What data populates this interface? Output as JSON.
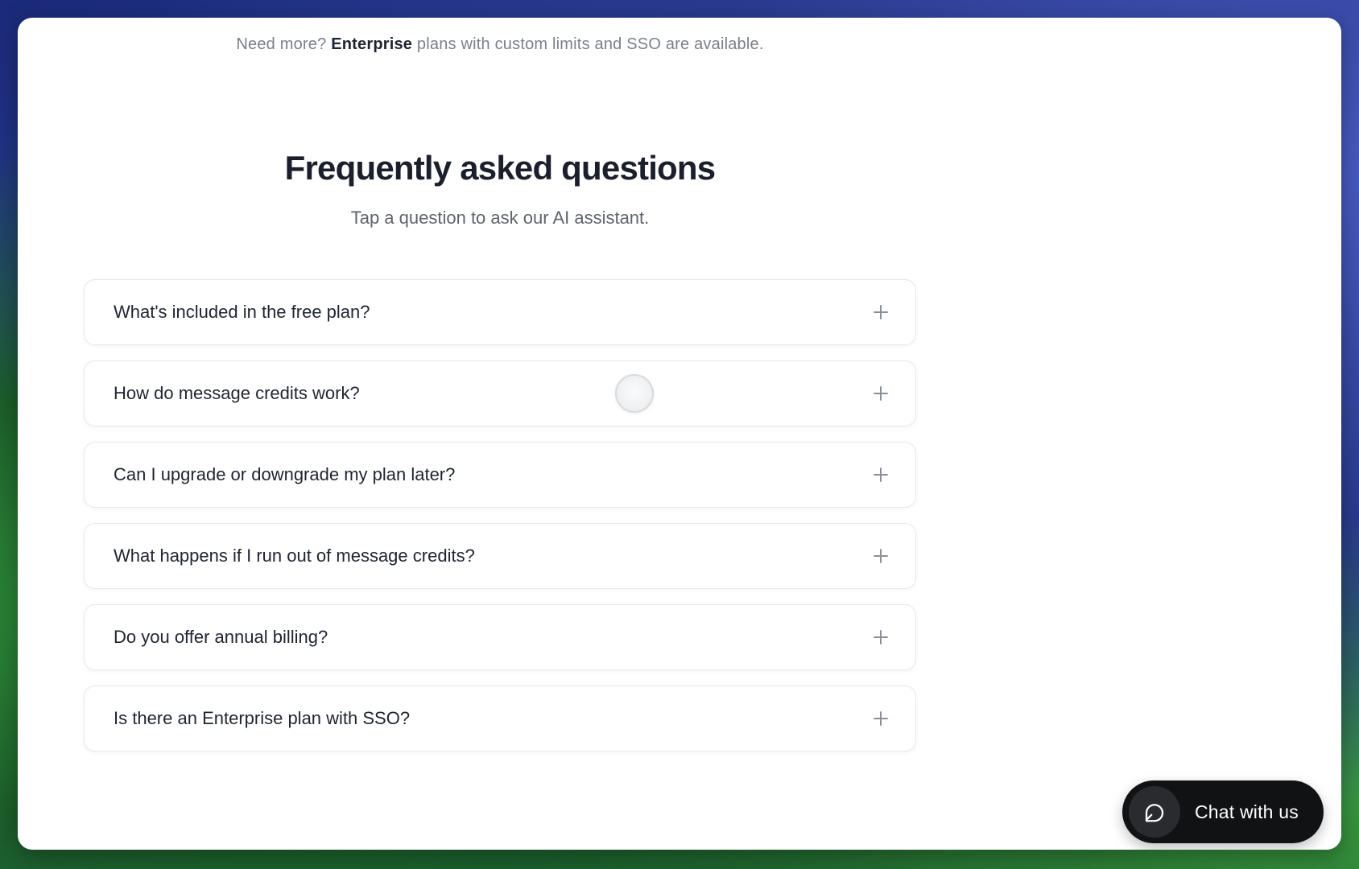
{
  "notice": {
    "prefix": "Need more?",
    "strong": "Enterprise",
    "suffix": "plans with custom limits and SSO are available."
  },
  "faq": {
    "title": "Frequently asked questions",
    "subtitle": "Tap a question to ask our AI assistant.",
    "items": [
      {
        "question": "What's included in the free plan?"
      },
      {
        "question": "How do message credits work?"
      },
      {
        "question": "Can I upgrade or downgrade my plan later?"
      },
      {
        "question": "What happens if I run out of message credits?"
      },
      {
        "question": "Do you offer annual billing?"
      },
      {
        "question": "Is there an Enterprise plan with SSO?"
      }
    ],
    "expand_icon": "plus-icon"
  },
  "chat_widget": {
    "label": "Chat with us",
    "icon": "chat-bubble-icon"
  }
}
